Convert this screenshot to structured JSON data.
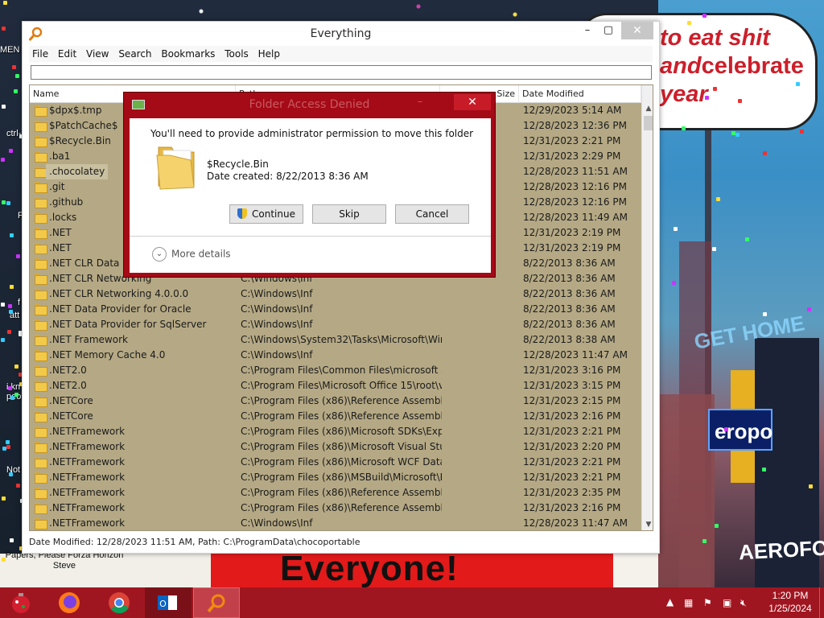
{
  "wallpaper": {
    "bubble_line1": "to eat shit",
    "bubble_line2a": "and",
    "bubble_line2b": "celebrate",
    "bubble_line3": "year",
    "banner_text": "Everyone!",
    "caption": "Papers, Please Forza Horizon Steve",
    "sign_get_home": "GET HOME",
    "sign_aerop": "eropo",
    "sign_aerofos": "AEROFOS",
    "desk_label_1": "MEN",
    "desk_label_2": "ctrl-",
    "desk_label_3": "F",
    "desk_label_4": "f",
    "desk_label_5": "att",
    "desk_label_6": "i kn peo",
    "desk_label_7": "Not",
    "accent_red": "#cc1f2a"
  },
  "everything": {
    "title": "Everything",
    "menu": [
      "File",
      "Edit",
      "View",
      "Search",
      "Bookmarks",
      "Tools",
      "Help"
    ],
    "search_value": "",
    "columns": {
      "name": "Name",
      "path": "Path",
      "size": "Size",
      "date": "Date Modified"
    },
    "rows": [
      {
        "name": "$dpx$.tmp",
        "path": "",
        "date": "12/29/2023 5:14 AM"
      },
      {
        "name": "$PatchCache$",
        "path": "",
        "date": "12/28/2023 12:36 PM"
      },
      {
        "name": "$Recycle.Bin",
        "path": "",
        "date": "12/31/2023 2:21 PM"
      },
      {
        "name": ".ba1",
        "path": "",
        "date": "12/31/2023 2:29 PM"
      },
      {
        "name": ".chocolatey",
        "path": "",
        "date": "12/28/2023 11:51 AM"
      },
      {
        "name": ".git",
        "path": "",
        "date": "12/28/2023 12:16 PM"
      },
      {
        "name": ".github",
        "path": "",
        "date": "12/28/2023 12:16 PM"
      },
      {
        "name": ".locks",
        "path": "",
        "date": "12/28/2023 11:49 AM"
      },
      {
        "name": ".NET",
        "path": "",
        "date": "12/31/2023 2:19 PM"
      },
      {
        "name": ".NET",
        "path": "",
        "date": "12/31/2023 2:19 PM"
      },
      {
        "name": ".NET CLR Data",
        "path": "",
        "date": "8/22/2013 8:36 AM"
      },
      {
        "name": ".NET CLR Networking",
        "path": "C:\\Windows\\Inf",
        "date": "8/22/2013 8:36 AM"
      },
      {
        "name": ".NET CLR Networking 4.0.0.0",
        "path": "C:\\Windows\\Inf",
        "date": "8/22/2013 8:36 AM"
      },
      {
        "name": ".NET Data Provider for Oracle",
        "path": "C:\\Windows\\Inf",
        "date": "8/22/2013 8:36 AM"
      },
      {
        "name": ".NET Data Provider for SqlServer",
        "path": "C:\\Windows\\Inf",
        "date": "8/22/2013 8:36 AM"
      },
      {
        "name": ".NET Framework",
        "path": "C:\\Windows\\System32\\Tasks\\Microsoft\\Win...",
        "date": "8/22/2013 8:38 AM"
      },
      {
        "name": ".NET Memory Cache 4.0",
        "path": "C:\\Windows\\Inf",
        "date": "12/28/2023 11:47 AM"
      },
      {
        "name": ".NET2.0",
        "path": "C:\\Program Files\\Common Files\\microsoft s...",
        "date": "12/31/2023 3:16 PM"
      },
      {
        "name": ".NET2.0",
        "path": "C:\\Program Files\\Microsoft Office 15\\root\\vf...",
        "date": "12/31/2023 3:15 PM"
      },
      {
        "name": ".NETCore",
        "path": "C:\\Program Files (x86)\\Reference Assemblies...",
        "date": "12/31/2023 2:15 PM"
      },
      {
        "name": ".NETCore",
        "path": "C:\\Program Files (x86)\\Reference Assemblies...",
        "date": "12/31/2023 2:16 PM"
      },
      {
        "name": ".NETFramework",
        "path": "C:\\Program Files (x86)\\Microsoft SDKs\\Expres...",
        "date": "12/31/2023 2:21 PM"
      },
      {
        "name": ".NETFramework",
        "path": "C:\\Program Files (x86)\\Microsoft Visual Studi...",
        "date": "12/31/2023 2:20 PM"
      },
      {
        "name": ".NETFramework",
        "path": "C:\\Program Files (x86)\\Microsoft WCF Data S...",
        "date": "12/31/2023 2:21 PM"
      },
      {
        "name": ".NETFramework",
        "path": "C:\\Program Files (x86)\\MSBuild\\Microsoft\\Ex...",
        "date": "12/31/2023 2:21 PM"
      },
      {
        "name": ".NETFramework",
        "path": "C:\\Program Files (x86)\\Reference Assemblies...",
        "date": "12/31/2023 2:35 PM"
      },
      {
        "name": ".NETFramework",
        "path": "C:\\Program Files (x86)\\Reference Assemblies...",
        "date": "12/31/2023 2:16 PM"
      },
      {
        "name": ".NETFramework",
        "path": "C:\\Windows\\Inf",
        "date": "12/28/2023 11:47 AM"
      }
    ],
    "selected_row": 4,
    "status": "Date Modified: 12/28/2023 11:51 AM, Path: C:\\ProgramData\\chocoportable",
    "list_bg": "#b5a985"
  },
  "dialog": {
    "title": "Folder Access Denied",
    "message": "You'll need to provide administrator permission to move this folder",
    "item_name": "$Recycle.Bin",
    "item_date": "Date created: 8/22/2013 8:36 AM",
    "continue_label": "Continue",
    "skip_label": "Skip",
    "cancel_label": "Cancel",
    "more_details": "More details",
    "frame_color": "#a50a17"
  },
  "taskbar": {
    "time": "1:20 PM",
    "date": "1/25/2024",
    "apps": [
      "start",
      "firefox",
      "chrome",
      "outlook",
      "everything"
    ],
    "color": "#a01620"
  }
}
